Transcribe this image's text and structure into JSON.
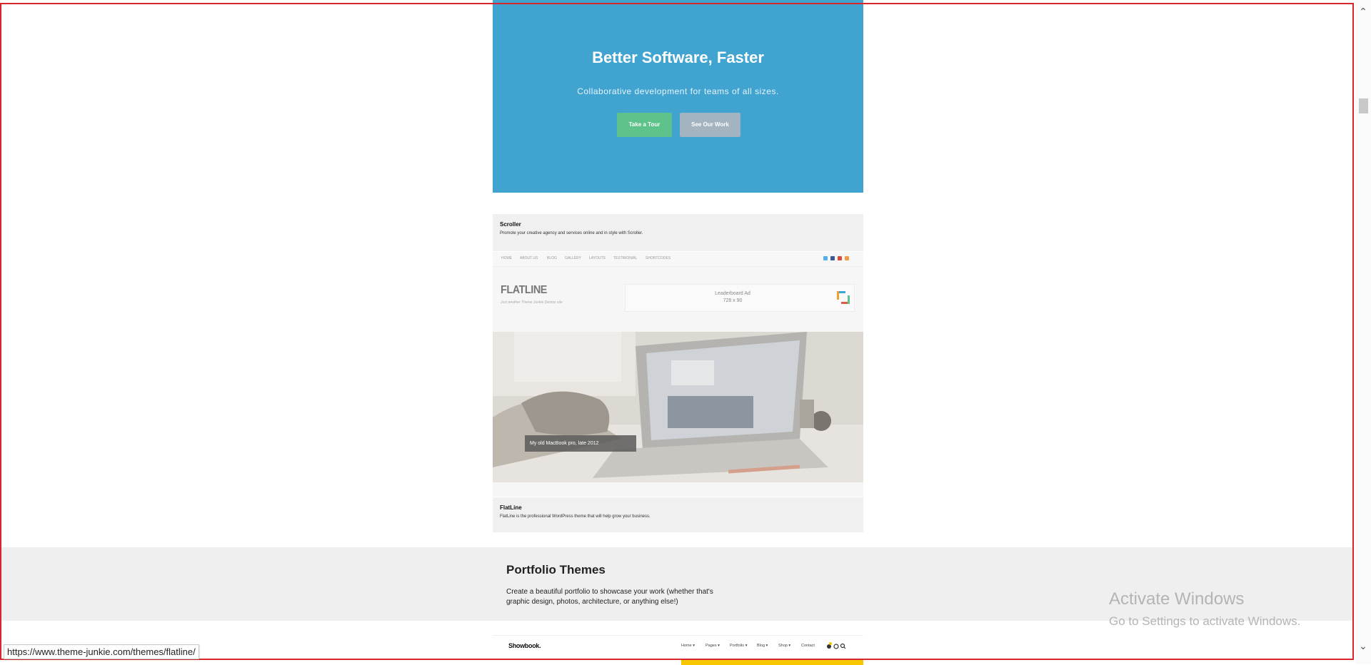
{
  "hero": {
    "title": "Better Software, Faster",
    "subtitle": "Collaborative development for teams of all sizes.",
    "primary_button": "Take a Tour",
    "secondary_button": "See Our Work",
    "background": "#40a3d0"
  },
  "scroller_card": {
    "title": "Scroller",
    "description": "Promote your creative agency and services online and in style with Scroller."
  },
  "flatline_demo": {
    "nav_items": [
      "HOME",
      "ABOUT US",
      "BLOG",
      "GALLERY",
      "LAYOUTS",
      "TESTIMONIAL",
      "SHORTCODES"
    ],
    "social_icons": [
      "twitter-icon",
      "facebook-icon",
      "google-plus-icon",
      "rss-icon"
    ],
    "logo": "FLATLINE",
    "tagline": "Just another Theme Junkie Demos site",
    "ad_line1": "Leaderboard Ad",
    "ad_line2": "728 x 90",
    "caption": "My old MacBook pro, late 2012"
  },
  "flatline_card": {
    "title": "FlatLine",
    "description": "FlatLine is the professional WordPress theme that will help grow your business."
  },
  "portfolio_section": {
    "title": "Portfolio Themes",
    "description": "Create a beautiful portfolio to showcase your work (whether that's graphic design, photos, architecture, or anything else!)"
  },
  "showbook_preview": {
    "logo": "Showbook.",
    "nav_items": [
      "Home ▾",
      "Pages ▾",
      "Portfolio ▾",
      "Blog ▾",
      "Shop ▾",
      "Contact"
    ],
    "accent": "#f7c600"
  },
  "watermark": {
    "line1": "Activate Windows",
    "line2": "Go to Settings to activate Windows."
  },
  "status_bar": {
    "url": "https://www.theme-junkie.com/themes/flatline/"
  }
}
